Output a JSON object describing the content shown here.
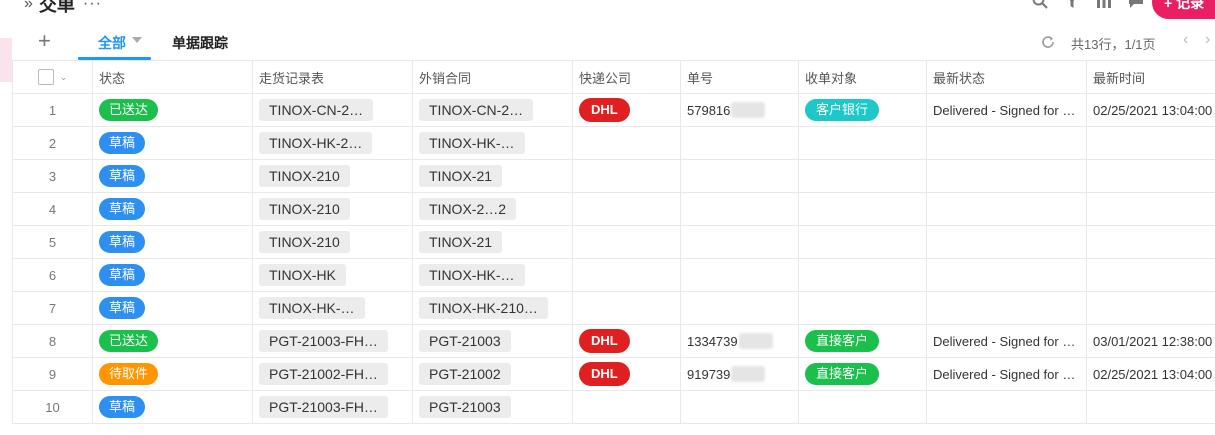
{
  "header": {
    "chevrons": "»",
    "title": "交单",
    "more": "···",
    "new_record_label": "+ 记录",
    "icons": [
      "search-icon",
      "filter-icon",
      "chart-icon",
      "comment-icon"
    ]
  },
  "toolbar": {
    "add_view": "+",
    "tabs": [
      {
        "label": "全部",
        "active": true
      },
      {
        "label": "单据跟踪",
        "active": false
      }
    ],
    "summary": "共13行，1/1页",
    "prev": "‹",
    "next": "›"
  },
  "table": {
    "columns": [
      "状态",
      "走货记录表",
      "外销合同",
      "快递公司",
      "单号",
      "收单对象",
      "最新状态",
      "最新时间"
    ],
    "rows": [
      {
        "num": "1",
        "status": "已送达",
        "status_color": "#1bbf4c",
        "shipping": "TINOX-CN-2…",
        "contract": "TINOX-CN-2…",
        "courier": "DHL",
        "tracking": "579816",
        "target": "客户银行",
        "target_color": "#1ec8c8",
        "latest_status": "Delivered - Signed for …",
        "latest_time": "02/25/2021 13:04:00"
      },
      {
        "num": "2",
        "status": "草稿",
        "status_color": "#2d8ff0",
        "shipping": "TINOX-HK-2…",
        "contract": "TINOX-HK-…",
        "courier": "",
        "tracking": "",
        "target": "",
        "target_color": "",
        "latest_status": "",
        "latest_time": ""
      },
      {
        "num": "3",
        "status": "草稿",
        "status_color": "#2d8ff0",
        "shipping": "TINOX-210",
        "contract": "TINOX-21",
        "courier": "",
        "tracking": "",
        "target": "",
        "target_color": "",
        "latest_status": "",
        "latest_time": ""
      },
      {
        "num": "4",
        "status": "草稿",
        "status_color": "#2d8ff0",
        "shipping": "TINOX-210",
        "contract": "TINOX-2…2",
        "courier": "",
        "tracking": "",
        "target": "",
        "target_color": "",
        "latest_status": "",
        "latest_time": ""
      },
      {
        "num": "5",
        "status": "草稿",
        "status_color": "#2d8ff0",
        "shipping": "TINOX-210",
        "contract": "TINOX-21",
        "courier": "",
        "tracking": "",
        "target": "",
        "target_color": "",
        "latest_status": "",
        "latest_time": ""
      },
      {
        "num": "6",
        "status": "草稿",
        "status_color": "#2d8ff0",
        "shipping": "TINOX-HK",
        "contract": "TINOX-HK-…",
        "courier": "",
        "tracking": "",
        "target": "",
        "target_color": "",
        "latest_status": "",
        "latest_time": ""
      },
      {
        "num": "7",
        "status": "草稿",
        "status_color": "#2d8ff0",
        "shipping": "TINOX-HK-…",
        "contract": "TINOX-HK-210…",
        "courier": "",
        "tracking": "",
        "target": "",
        "target_color": "",
        "latest_status": "",
        "latest_time": ""
      },
      {
        "num": "8",
        "status": "已送达",
        "status_color": "#1bbf4c",
        "shipping": "PGT-21003-FH…",
        "contract": "PGT-21003",
        "courier": "DHL",
        "tracking": "1334739",
        "target": "直接客户",
        "target_color": "#1bbf4c",
        "latest_status": "Delivered - Signed for …",
        "latest_time": "03/01/2021 12:38:00"
      },
      {
        "num": "9",
        "status": "待取件",
        "status_color": "#ff9500",
        "shipping": "PGT-21002-FH…",
        "contract": "PGT-21002",
        "courier": "DHL",
        "tracking": "919739",
        "target": "直接客户",
        "target_color": "#1bbf4c",
        "latest_status": "Delivered - Signed for …",
        "latest_time": "02/25/2021 13:04:00"
      },
      {
        "num": "10",
        "status": "草稿",
        "status_color": "#2d8ff0",
        "shipping": "PGT-21003-FH…",
        "contract": "PGT-21003",
        "courier": "",
        "tracking": "",
        "target": "",
        "target_color": "",
        "latest_status": "",
        "latest_time": ""
      }
    ]
  }
}
